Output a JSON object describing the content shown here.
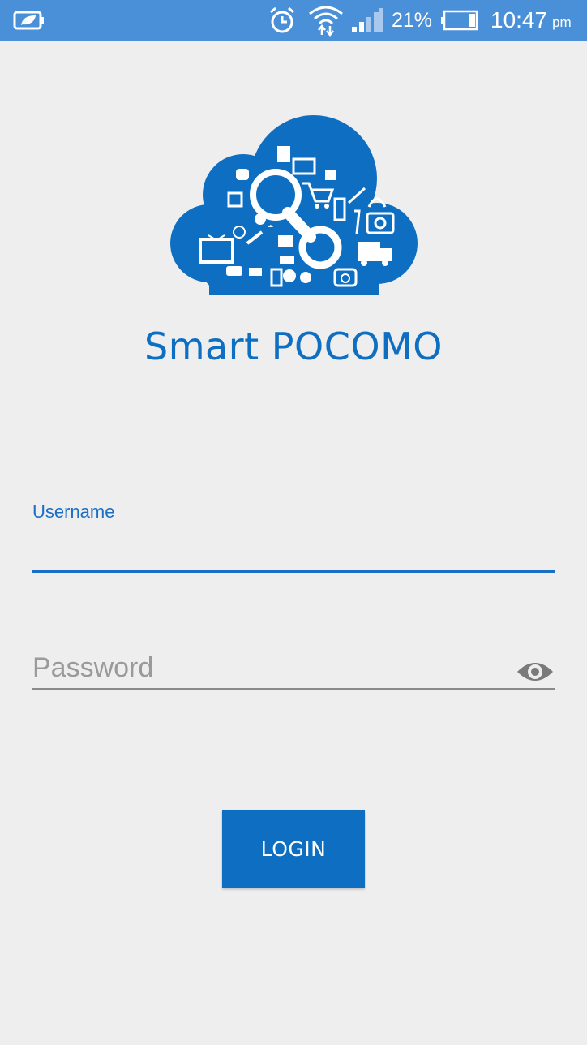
{
  "status_bar": {
    "battery_percent": "21%",
    "time": "10:47",
    "ampm": "pm",
    "icons": [
      "leaf-battery-icon",
      "alarm-icon",
      "wifi-icon",
      "signal-icon",
      "battery-icon"
    ]
  },
  "app": {
    "title": "Smart POCOMO",
    "brand_color": "#0e6fc2"
  },
  "form": {
    "username_label": "Username",
    "username_value": "",
    "password_placeholder": "Password",
    "password_value": "",
    "login_label": "LOGIN"
  }
}
